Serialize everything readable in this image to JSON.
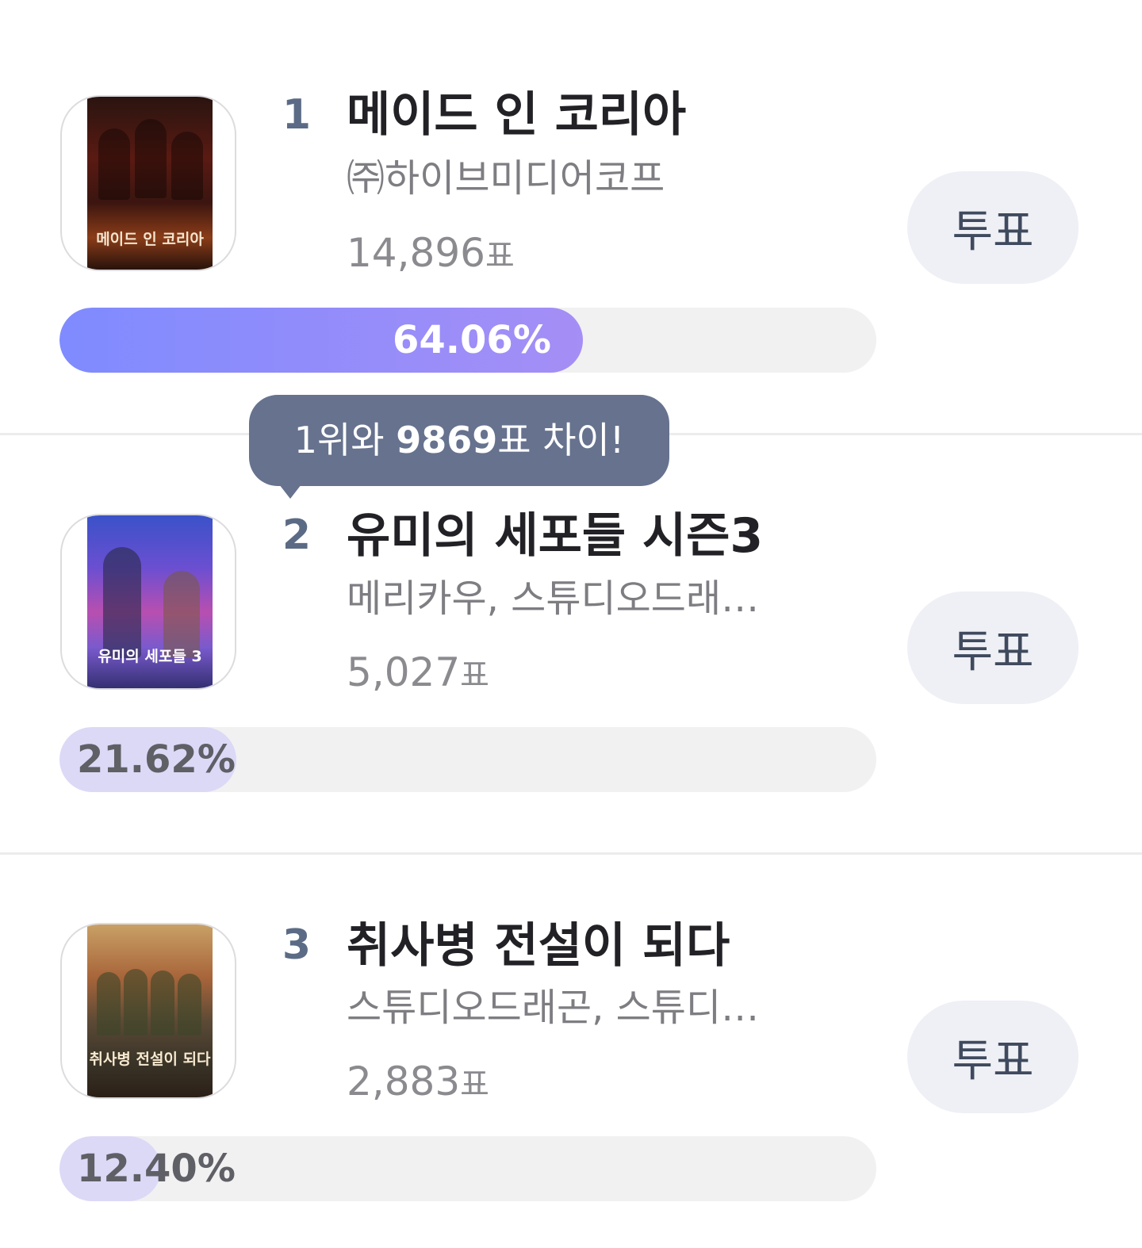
{
  "items": [
    {
      "rank": "1",
      "title": "메이드 인 코리아",
      "producer": "㈜하이브미디어코프",
      "votes": "14,896",
      "votes_unit": "표",
      "percent_label": "64.06%",
      "percent": 64.06,
      "vote_label": "투표",
      "poster_caption": "메이드 인 코리아",
      "fill_color": "#8f8dfb"
    },
    {
      "rank": "2",
      "title": "유미의 세포들 시즌3",
      "producer": "메리카우, 스튜디오드래…",
      "votes": "5,027",
      "votes_unit": "표",
      "percent_label": "21.62%",
      "percent": 21.62,
      "vote_label": "투표",
      "poster_caption": "유미의 세포들 3",
      "fill_color": "#dcd9f7"
    },
    {
      "rank": "3",
      "title": "취사병 전설이 되다",
      "producer": "스튜디오드래곤, 스튜디…",
      "votes": "2,883",
      "votes_unit": "표",
      "percent_label": "12.40%",
      "percent": 12.4,
      "vote_label": "투표",
      "poster_caption": "취사병 전설이 되다",
      "fill_color": "#dcd9f7"
    }
  ],
  "tooltip": {
    "prefix": "1위와 ",
    "gap": "9869",
    "suffix": "표 차이!"
  }
}
